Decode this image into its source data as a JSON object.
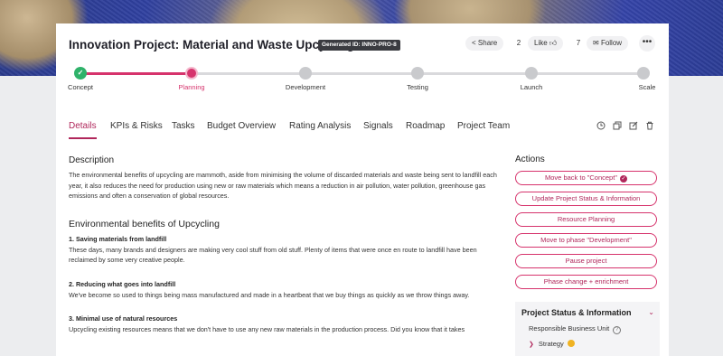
{
  "header": {
    "title": "Innovation Project: Material and Waste Upcycling",
    "generated_id": "Generated ID: INNO-PRO-8",
    "share_label": "Share",
    "like_count": "2",
    "like_label": "Like",
    "follow_count": "7",
    "follow_label": "Follow",
    "more_label": "•••"
  },
  "phases": [
    {
      "label": "Concept",
      "state": "done"
    },
    {
      "label": "Planning",
      "state": "active"
    },
    {
      "label": "Development",
      "state": "todo"
    },
    {
      "label": "Testing",
      "state": "todo"
    },
    {
      "label": "Launch",
      "state": "todo"
    },
    {
      "label": "Scale",
      "state": "todo"
    }
  ],
  "tabs": [
    {
      "label": "Details",
      "active": true
    },
    {
      "label": "KPIs & Risks"
    },
    {
      "label": "Tasks"
    },
    {
      "label": "Budget Overview"
    },
    {
      "label": "Rating Analysis"
    },
    {
      "label": "Signals"
    },
    {
      "label": "Roadmap"
    },
    {
      "label": "Project Team"
    }
  ],
  "tab_tools": [
    "history-icon",
    "copy-icon",
    "edit-icon",
    "trash-icon"
  ],
  "description": {
    "heading": "Description",
    "text": "The environmental benefits of upcycling are mammoth, aside from minimising the volume of discarded materials and waste being sent to landfill each year, it also reduces the need for production using new or raw materials which means a reduction in air pollution, water pollution, greenhouse gas emissions and often a conservation of global resources."
  },
  "benefits": {
    "heading": "Environmental benefits of Upcycling",
    "items": [
      {
        "title": "1. Saving materials from landfill",
        "text": "These days, many brands and designers are making very cool stuff from old stuff. Plenty of items that were once en route to landfill have been reclaimed by some very creative people."
      },
      {
        "title": "2. Reducing what goes into landfill",
        "text": "We've become so used to things being mass manufactured and made in a heartbeat that we buy things as quickly as we throw things away."
      },
      {
        "title": "3. Minimal use of natural resources",
        "text": "Upcycling existing resources means that we don't have to use any new raw materials in the production process. Did you know that it takes"
      }
    ]
  },
  "actions": {
    "heading": "Actions",
    "buttons": [
      "Move back to \"Concept\"",
      "Update Project Status & Information",
      "Resource Planning",
      "Move to phase \"Development\"",
      "Pause project",
      "Phase change + enrichment"
    ]
  },
  "status_panel": {
    "title": "Project Status & Information",
    "responsible_label": "Responsible Business Unit",
    "item_label": "Strategy",
    "item_color": "#f0b323"
  },
  "colors": {
    "accent": "#d6336c",
    "done": "#2fb26a",
    "todo": "#c9cacd"
  }
}
